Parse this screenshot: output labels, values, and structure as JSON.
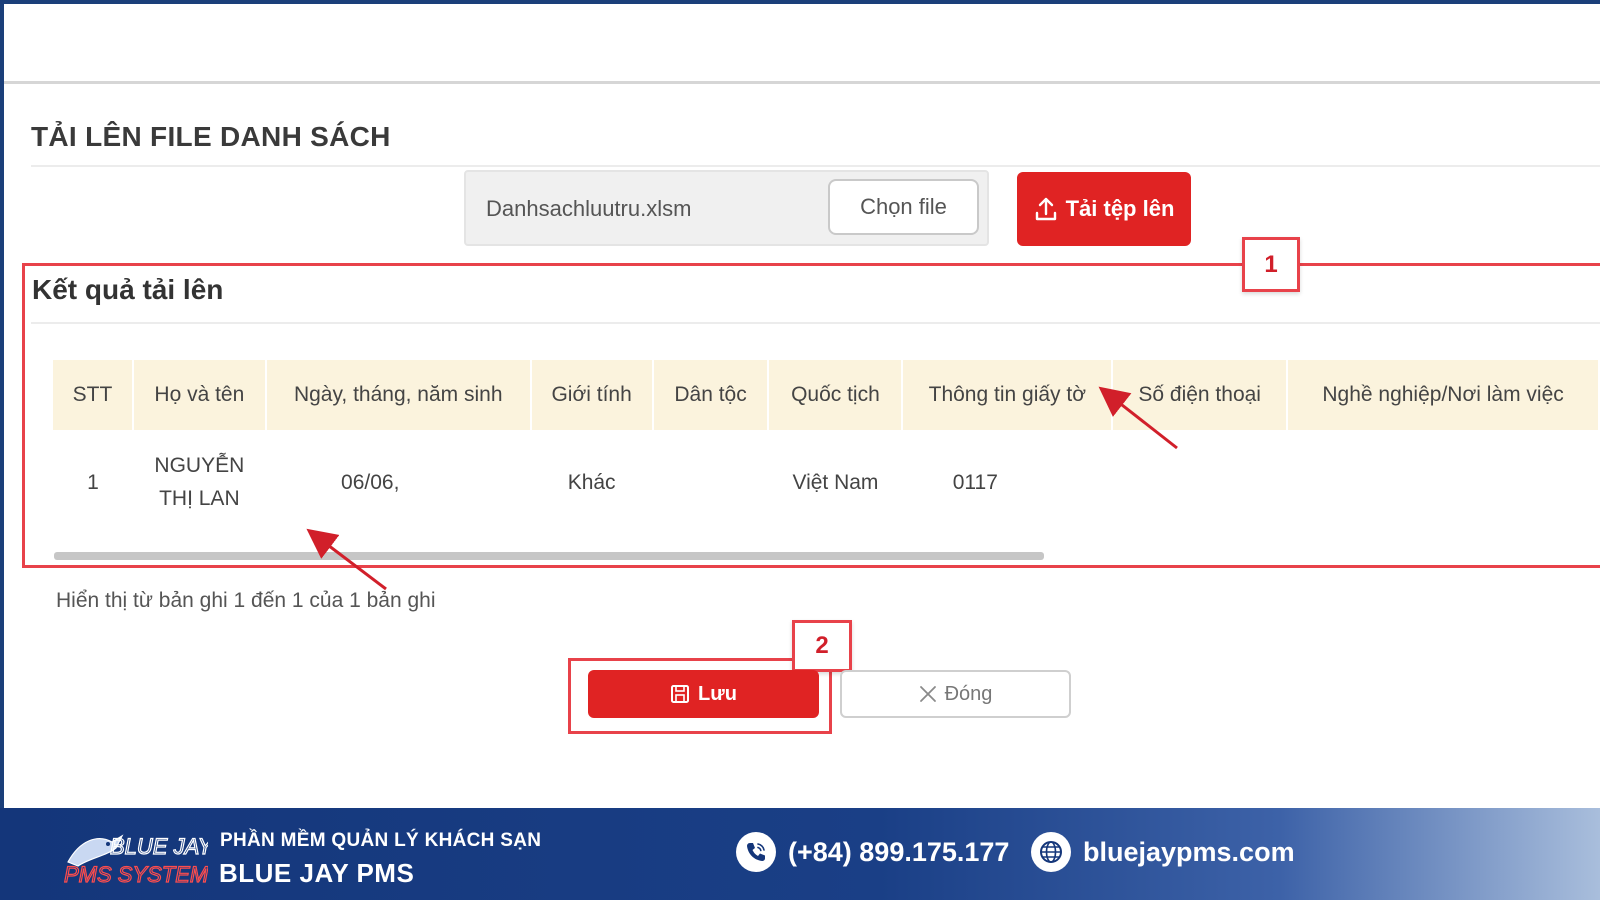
{
  "page": {
    "title": "TẢI LÊN FILE DANH SÁCH"
  },
  "upload": {
    "file_name": "Danhsachluutru.xlsm",
    "choose_label": "Chọn file",
    "upload_label": "Tải tệp lên",
    "upload_icon": "upload-icon"
  },
  "results": {
    "title": "Kết quả tải lên",
    "columns": [
      "STT",
      "Họ và tên",
      "Ngày, tháng, năm sinh",
      "Giới tính",
      "Dân tộc",
      "Quốc tịch",
      "Thông tin giấy tờ",
      "Số điện thoại",
      "Nghề nghiệp/Nơi làm việc"
    ],
    "rows": [
      {
        "stt": "1",
        "name_line1": "NGUYỄN",
        "name_line2": "THỊ LAN",
        "dob": "06/06,",
        "gender": "Khác",
        "ethnicity": "",
        "nationality": "Việt Nam",
        "document": "0117",
        "phone": "",
        "occupation": ""
      }
    ],
    "pager_info": "Hiển thị từ bản ghi 1 đến 1 của 1 bản ghi"
  },
  "actions": {
    "save_label": "Lưu",
    "close_label": "Đóng",
    "save_icon": "save-icon",
    "close_icon": "close-icon"
  },
  "annotations": {
    "label_1": "1",
    "label_2": "2",
    "color": "#e8424a"
  },
  "footer": {
    "logo_text_1": "BLUE JAY",
    "logo_text_2": "PMS SYSTEM",
    "tagline": "PHẦN MỀM QUẢN LÝ KHÁCH SẠN",
    "brand": "BLUE JAY PMS",
    "phone": "(+84) 899.175.177",
    "website": "bluejaypms.com"
  },
  "colors": {
    "primary_red": "#e02323",
    "header_bg": "#fbf3dd",
    "footer_blue": "#14367a"
  }
}
